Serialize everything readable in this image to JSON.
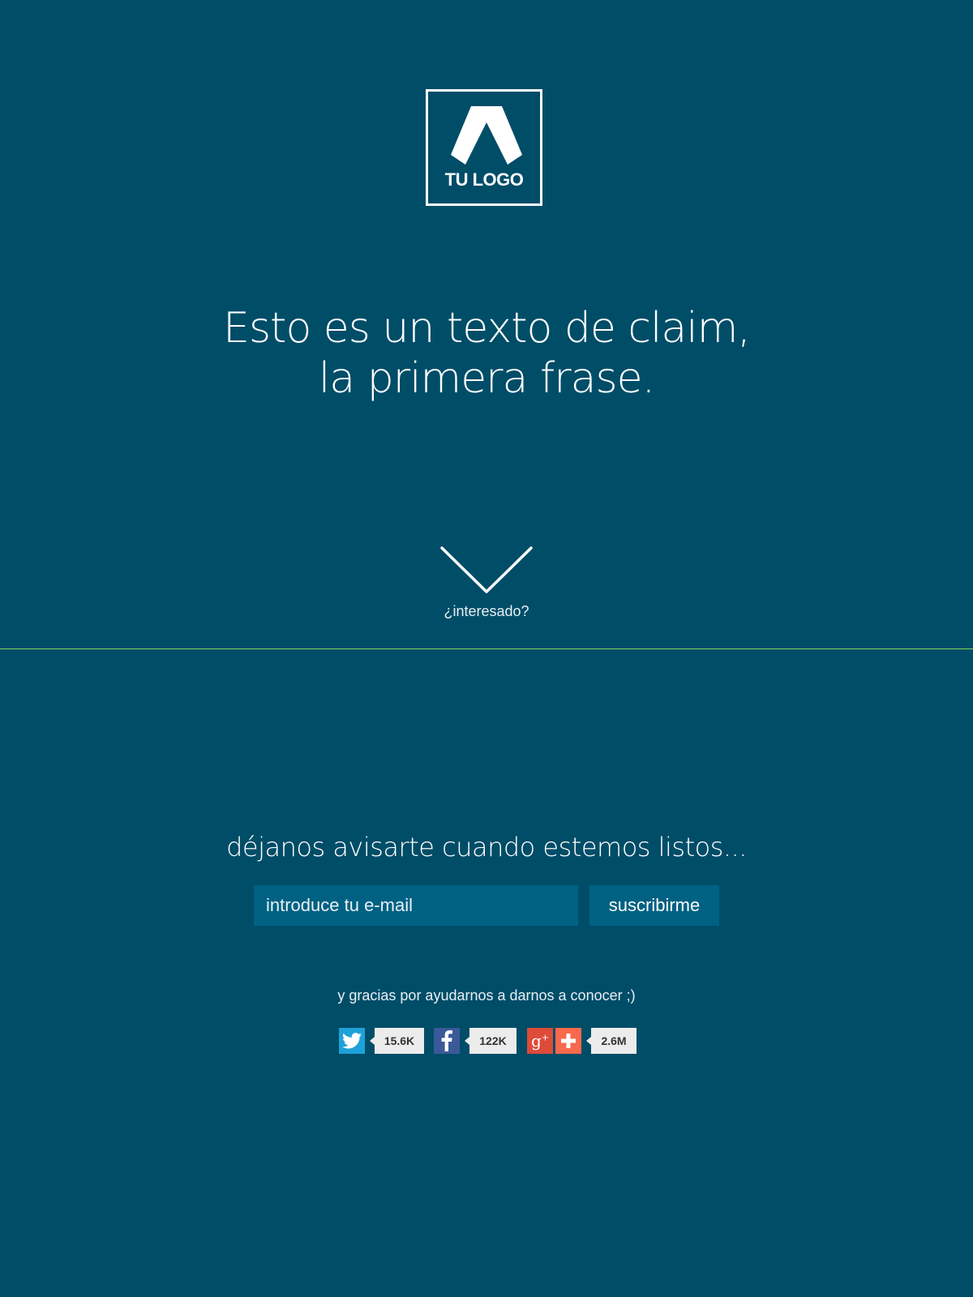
{
  "logo": {
    "text": "TU LOGO",
    "icon": "a-letter-logo-icon"
  },
  "claim": {
    "line1": "Esto es un texto de claim,",
    "line2": "la primera frase."
  },
  "scroll_cue": {
    "icon": "chevron-down-icon",
    "label": "¿interesado?"
  },
  "subscribe": {
    "heading": "déjanos avisarte cuando estemos listos...",
    "email_placeholder": "introduce tu e-mail",
    "button_label": "suscribirme"
  },
  "thanks_text": "y gracias por ayudarnos a darnos a conocer ;)",
  "share": [
    {
      "network": "twitter",
      "icon": "twitter-icon",
      "count": "15.6K",
      "color": "#1da1d8"
    },
    {
      "network": "facebook",
      "icon": "facebook-icon",
      "count": "122K",
      "color": "#3b5998"
    },
    {
      "network": "googleplus",
      "icon": "google-plus-icon",
      "count": "2.6M",
      "color": "#dd4b39"
    },
    {
      "network": "addthis",
      "icon": "plus-icon",
      "count": "",
      "color": "#f8694d"
    }
  ],
  "colors": {
    "background": "#004d68",
    "input": "#006183",
    "divider": "#7ed957"
  }
}
